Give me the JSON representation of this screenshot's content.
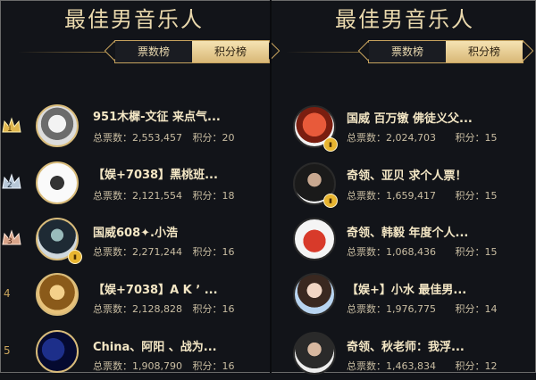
{
  "left": {
    "title": "最佳男音乐人",
    "tabs": [
      "票数榜",
      "积分榜"
    ],
    "rows": [
      {
        "rank": "1",
        "name": "951木樨-文征 来点气...",
        "votes_label": "总票数：",
        "votes": "2,553,457",
        "score_label": "积分：",
        "score": "20"
      },
      {
        "rank": "2",
        "name": "【娱+7038】黑桃班...",
        "votes_label": "总票数：",
        "votes": "2,121,554",
        "score_label": "积分：",
        "score": "18"
      },
      {
        "rank": "3",
        "name": "国威608✦.小浩",
        "votes_label": "总票数：",
        "votes": "2,271,244",
        "score_label": "积分：",
        "score": "16"
      },
      {
        "rank": "4",
        "name": "【娱+7038】A K ʼ ...",
        "votes_label": "总票数：",
        "votes": "2,128,828",
        "score_label": "积分：",
        "score": "16"
      },
      {
        "rank": "5",
        "name": "China、阿阳 、战为...",
        "votes_label": "总票数：",
        "votes": "1,908,790",
        "score_label": "积分：",
        "score": "16"
      }
    ]
  },
  "right": {
    "title": "最佳男音乐人",
    "tabs": [
      "票数榜",
      "积分榜"
    ],
    "rows": [
      {
        "name": "国威 百万镦 佛徒义父...",
        "votes_label": "总票数：",
        "votes": "2,024,703",
        "score_label": "积分：",
        "score": "15"
      },
      {
        "name": "奇领、亚贝 求个人票！",
        "votes_label": "总票数：",
        "votes": "1,659,417",
        "score_label": "积分：",
        "score": "15"
      },
      {
        "name": "奇领、韩毅 年度个人...",
        "votes_label": "总票数：",
        "votes": "1,068,436",
        "score_label": "积分：",
        "score": "15"
      },
      {
        "name": "【娱+】小水 最佳男...",
        "votes_label": "总票数：",
        "votes": "1,976,775",
        "score_label": "积分：",
        "score": "14"
      },
      {
        "name": "奇领、秋老师：我浮...",
        "votes_label": "总票数：",
        "votes": "1,463,834",
        "score_label": "积分：",
        "score": "12"
      }
    ]
  },
  "colors": {
    "accent": "#d9b877",
    "background": "#121419"
  }
}
